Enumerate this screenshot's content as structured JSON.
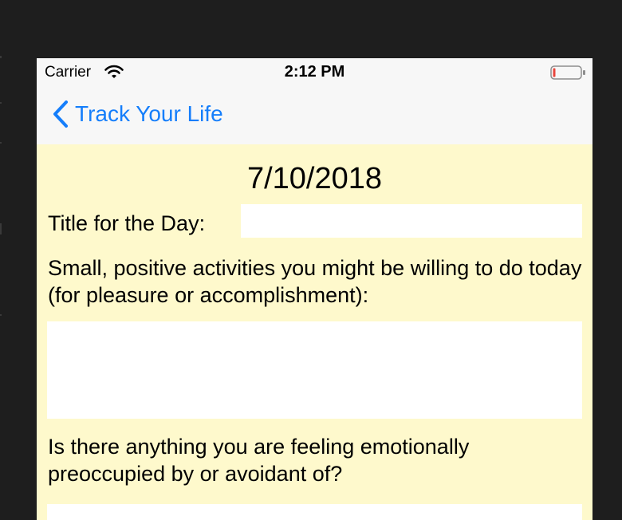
{
  "status_bar": {
    "carrier": "Carrier",
    "time": "2:12 PM",
    "wifi_icon": "wifi-icon",
    "battery_icon": "battery-low-icon",
    "battery_color": "#e8453c"
  },
  "nav": {
    "back_label": "Track Your Life",
    "back_icon": "chevron-left-icon",
    "accent_color": "#157efb"
  },
  "entry": {
    "date": "7/10/2018",
    "title_label": "Title for the Day:",
    "title_value": "",
    "activities_question": "Small, positive activities you might be willing to do today (for pleasure or accomplishment):",
    "activities_value": "",
    "emotional_question": "Is there anything you are feeling emotionally preoccupied by or avoidant of?",
    "emotional_value": ""
  },
  "colors": {
    "background": "#fef9cc",
    "bar_background": "#f7f7f7",
    "field_background": "#ffffff"
  }
}
